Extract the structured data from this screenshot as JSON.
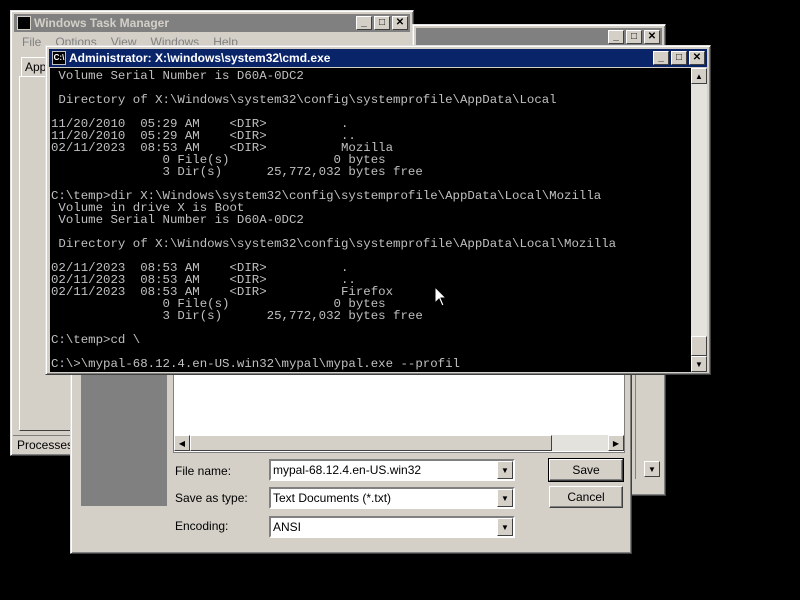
{
  "task_manager": {
    "title": "Windows Task Manager",
    "menu": [
      "File",
      "Options",
      "View",
      "Windows",
      "Help"
    ],
    "tab_partial": "App",
    "status_partial": "Processes"
  },
  "cmd": {
    "title": "Administrator: X:\\windows\\system32\\cmd.exe",
    "lines": [
      " Volume Serial Number is D60A-0DC2",
      "",
      " Directory of X:\\Windows\\system32\\config\\systemprofile\\AppData\\Local",
      "",
      "11/20/2010  05:29 AM    <DIR>          .",
      "11/20/2010  05:29 AM    <DIR>          ..",
      "02/11/2023  08:53 AM    <DIR>          Mozilla",
      "               0 File(s)              0 bytes",
      "               3 Dir(s)      25,772,032 bytes free",
      "",
      "C:\\temp>dir X:\\Windows\\system32\\config\\systemprofile\\AppData\\Local\\Mozilla",
      " Volume in drive X is Boot",
      " Volume Serial Number is D60A-0DC2",
      "",
      " Directory of X:\\Windows\\system32\\config\\systemprofile\\AppData\\Local\\Mozilla",
      "",
      "02/11/2023  08:53 AM    <DIR>          .",
      "02/11/2023  08:53 AM    <DIR>          ..",
      "02/11/2023  08:53 AM    <DIR>          Firefox",
      "               0 File(s)              0 bytes",
      "               3 Dir(s)      25,772,032 bytes free",
      "",
      "C:\\temp>cd \\",
      "",
      "C:\\>\\mypal-68.12.4.en-US.win32\\mypal\\mypal.exe --profil"
    ]
  },
  "save_dialog": {
    "file_name_label": "File name:",
    "file_name_value": "mypal-68.12.4.en-US.win32",
    "save_as_type_label": "Save as type:",
    "save_as_type_value": "Text Documents (*.txt)",
    "encoding_label": "Encoding:",
    "encoding_value": "ANSI",
    "save_button": "Save",
    "cancel_button": "Cancel"
  },
  "colors": {
    "desktop": "#000000",
    "active_title": "#0a246a",
    "inactive_title": "#808080",
    "console_text": "#c0c0c0"
  }
}
